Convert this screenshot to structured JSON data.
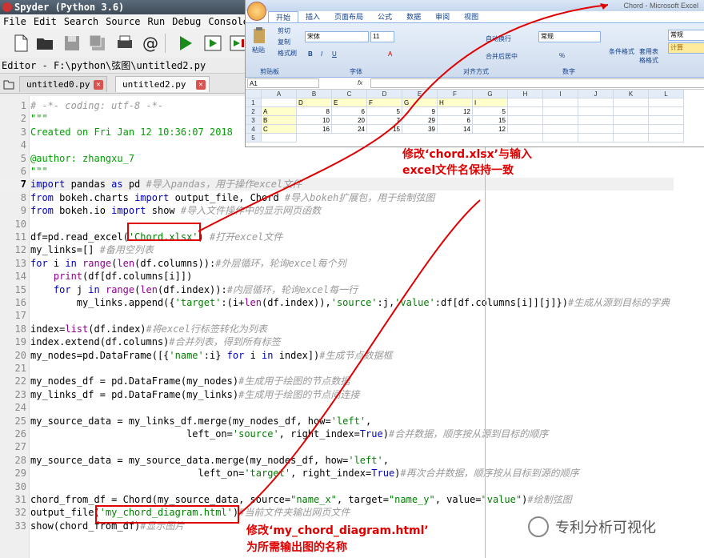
{
  "spyder": {
    "title": "Spyder (Python 3.6)",
    "menu": [
      "File",
      "Edit",
      "Search",
      "Source",
      "Run",
      "Debug",
      "Consoles"
    ],
    "editor_path": "Editor - F:\\python\\弦图\\untitled2.py",
    "tabs": [
      {
        "label": "untitled0.py",
        "active": false
      },
      {
        "label": "untitled2.py",
        "active": true
      }
    ],
    "current_line": 7
  },
  "code_lines": [
    {
      "n": "1",
      "html": "<span class=\"cm\"># -*- coding: utf-8 -*-</span>"
    },
    {
      "n": "2",
      "html": "<span class=\"st\">\"\"\"</span>"
    },
    {
      "n": "3",
      "html": "<span class=\"st\">Created on Fri Jan 12 10:36:07 2018</span>"
    },
    {
      "n": "4",
      "html": ""
    },
    {
      "n": "5",
      "html": "<span class=\"st\">@author: zhangxu_7</span>"
    },
    {
      "n": "6",
      "html": "<span class=\"st\">\"\"\"</span>"
    },
    {
      "n": "7",
      "html": "<span class=\"kw\">import</span> pandas <span class=\"kw\">as</span> pd <span class=\"cm\">#导入pandas，用于操作excel文件</span>"
    },
    {
      "n": "8",
      "html": "<span class=\"kw\">from</span> bokeh.charts <span class=\"kw\">import</span> output_file, Chord <span class=\"cm\">#导入bokeh扩展包，用于绘制弦图</span>"
    },
    {
      "n": "9",
      "html": "<span class=\"kw\">from</span> bokeh.io <span class=\"kw\">import</span> show <span class=\"cm\">#导入文件操作中的显示网页函数</span>"
    },
    {
      "n": "10",
      "html": ""
    },
    {
      "n": "11",
      "html": "df=pd.read_excel(<span class=\"str\">'Chord.xlsx'</span>) <span class=\"cm\">#打开excel文件</span>"
    },
    {
      "n": "12",
      "html": "my_links=[] <span class=\"cm\">#备用空列表</span>"
    },
    {
      "n": "13",
      "html": "<span class=\"kw\">for</span> i <span class=\"kw\">in</span> <span class=\"bi\">range</span>(<span class=\"bi\">len</span>(df.columns)):<span class=\"cm\">#外层循环，轮询excel每个列</span>"
    },
    {
      "n": "14",
      "html": "    <span class=\"bi\">print</span>(df[df.columns[i]])"
    },
    {
      "n": "15",
      "html": "    <span class=\"kw\">for</span> j <span class=\"kw\">in</span> <span class=\"bi\">range</span>(<span class=\"bi\">len</span>(df.index)):<span class=\"cm\">#内层循环，轮询excel每一行</span>"
    },
    {
      "n": "16",
      "html": "        my_links.append({<span class=\"str\">'target'</span>:(i+<span class=\"bi\">len</span>(df.index)),<span class=\"str\">'source'</span>:j,<span class=\"str\">'value'</span>:df[df.columns[i]][j]})<span class=\"cm\">#生成从源到目标的字典</span>"
    },
    {
      "n": "17",
      "html": ""
    },
    {
      "n": "18",
      "html": "index=<span class=\"bi\">list</span>(df.index)<span class=\"cm\">#将excel行标签转化为列表</span>"
    },
    {
      "n": "19",
      "html": "index.extend(df.columns)<span class=\"cm\">#合并列表，得到所有标签</span>"
    },
    {
      "n": "20",
      "html": "my_nodes=pd.DataFrame([{<span class=\"str\">'name'</span>:i} <span class=\"kw\">for</span> i <span class=\"kw\">in</span> index])<span class=\"cm\">#生成节点数据框</span>"
    },
    {
      "n": "21",
      "html": ""
    },
    {
      "n": "22",
      "html": "my_nodes_df = pd.DataFrame(my_nodes)<span class=\"cm\">#生成用于绘图的节点数据</span>"
    },
    {
      "n": "23",
      "html": "my_links_df = pd.DataFrame(my_links)<span class=\"cm\">#生成用于绘图的节点间连接</span>"
    },
    {
      "n": "24",
      "html": ""
    },
    {
      "n": "25",
      "html": "my_source_data = my_links_df.merge(my_nodes_df, how=<span class=\"str\">'left'</span>,"
    },
    {
      "n": "26",
      "html": "                           left_on=<span class=\"str\">'source'</span>, right_index=<span class=\"kw\">True</span>)<span class=\"cm\">#合并数据，顺序按从源到目标的顺序</span>"
    },
    {
      "n": "27",
      "html": ""
    },
    {
      "n": "28",
      "html": "my_source_data = my_source_data.merge(my_nodes_df, how=<span class=\"str\">'left'</span>,"
    },
    {
      "n": "29",
      "html": "                             left_on=<span class=\"str\">'target'</span>, right_index=<span class=\"kw\">True</span>)<span class=\"cm\">#再次合并数据，顺序按从目标到源的顺序</span>"
    },
    {
      "n": "30",
      "html": ""
    },
    {
      "n": "31",
      "html": "chord_from_df = Chord(my_source_data, source=<span class=\"str\">\"name_x\"</span>, target=<span class=\"str\">\"name_y\"</span>, value=<span class=\"str\">\"value\"</span>)<span class=\"cm\">#绘制弦图</span>"
    },
    {
      "n": "32",
      "html": "output_file(<span class=\"str\">'my_chord_diagram.html'</span>)<span class=\"cm\">#当前文件夹输出网页文件</span>"
    },
    {
      "n": "33",
      "html": "show(chord_from_df)<span class=\"cm\">#显示图片</span>"
    }
  ],
  "excel": {
    "title": "Chord - Microsoft Excel",
    "tabs": [
      "开始",
      "插入",
      "页面布局",
      "公式",
      "数据",
      "审阅",
      "视图"
    ],
    "ribbon": {
      "paste": "粘贴",
      "cut": "剪切",
      "copy": "复制",
      "format_painter": "格式刷",
      "clipboard": "剪贴板",
      "font_name": "宋体",
      "font_size": "11",
      "font": "字体",
      "wrap": "自动换行",
      "merge": "合并后居中",
      "alignment": "对齐方式",
      "number_format": "常规",
      "number": "数字",
      "cond_format": "条件格式",
      "table_format": "套用表格格式",
      "style_normal": "常规",
      "style_calc": "计算"
    },
    "name_box": "A1",
    "fx": "fx",
    "col_headers": [
      "A",
      "B",
      "C",
      "D",
      "E",
      "F",
      "G",
      "H",
      "I",
      "J",
      "K",
      "L"
    ],
    "row_headers": [
      "1",
      "2",
      "3",
      "4",
      "5"
    ],
    "header_row": [
      "",
      "D",
      "E",
      "F",
      "G",
      "H",
      "I"
    ],
    "rows": [
      [
        "A",
        "8",
        "6",
        "5",
        "9",
        "12",
        "5"
      ],
      [
        "B",
        "10",
        "20",
        "7",
        "29",
        "6",
        "15"
      ],
      [
        "C",
        "16",
        "24",
        "15",
        "39",
        "14",
        "12"
      ]
    ]
  },
  "annotations": {
    "note1_line1": "修改‘chord.xlsx’与输入",
    "note1_line2": "excel文件名保持一致",
    "note2_line1": "修改‘my_chord_diagram.html’",
    "note2_line2": "为所需输出图的名称",
    "annotation_color": "#e00000"
  },
  "watermark": "专利分析可视化"
}
